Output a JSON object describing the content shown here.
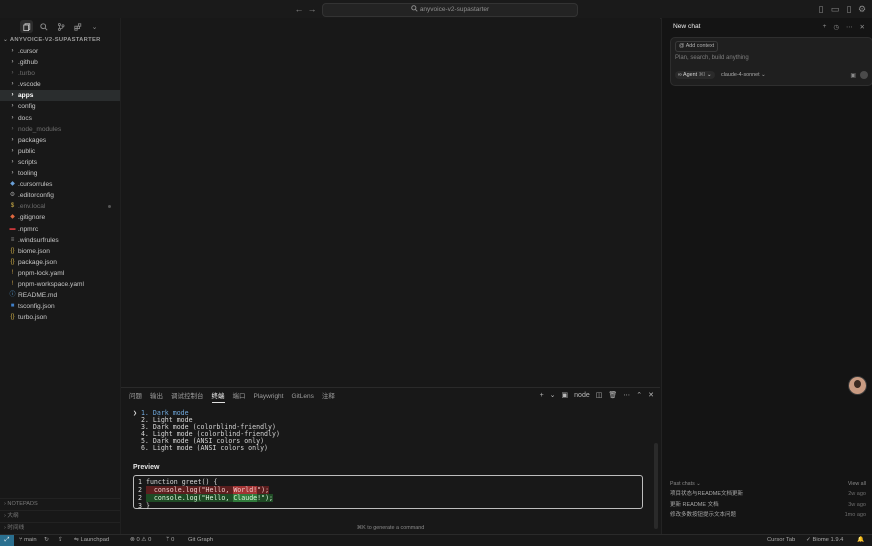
{
  "titlebar": {
    "search_text": "anyvoice-v2-supastarter"
  },
  "explorer": {
    "root": "ANYVOICE-V2-SUPASTARTER",
    "items": [
      {
        "label": ".cursor",
        "icon": "chevron-right-icon",
        "glyph": "›",
        "dim": false,
        "selected": false
      },
      {
        "label": ".github",
        "icon": "chevron-right-icon",
        "glyph": "›",
        "dim": false,
        "selected": false
      },
      {
        "label": ".turbo",
        "icon": "chevron-right-icon",
        "glyph": "›",
        "dim": true,
        "selected": false
      },
      {
        "label": ".vscode",
        "icon": "chevron-right-icon",
        "glyph": "›",
        "dim": false,
        "selected": false
      },
      {
        "label": "apps",
        "icon": "chevron-right-icon",
        "glyph": "›",
        "dim": false,
        "selected": true
      },
      {
        "label": "config",
        "icon": "chevron-right-icon",
        "glyph": "›",
        "dim": false,
        "selected": false
      },
      {
        "label": "docs",
        "icon": "chevron-right-icon",
        "glyph": "›",
        "dim": false,
        "selected": false
      },
      {
        "label": "node_modules",
        "icon": "chevron-right-icon",
        "glyph": "›",
        "dim": true,
        "selected": false
      },
      {
        "label": "packages",
        "icon": "chevron-right-icon",
        "glyph": "›",
        "dim": false,
        "selected": false
      },
      {
        "label": "public",
        "icon": "chevron-right-icon",
        "glyph": "›",
        "dim": false,
        "selected": false
      },
      {
        "label": "scripts",
        "icon": "chevron-right-icon",
        "glyph": "›",
        "dim": false,
        "selected": false
      },
      {
        "label": "tooling",
        "icon": "chevron-right-icon",
        "glyph": "›",
        "dim": false,
        "selected": false
      },
      {
        "label": ".cursorrules",
        "icon": "cursor-file-icon",
        "glyph": "◆",
        "color": "#6aa0d8",
        "dim": false,
        "selected": false
      },
      {
        "label": ".editorconfig",
        "icon": "gear-file-icon",
        "glyph": "⚙",
        "color": "#9a9a9a",
        "dim": false,
        "selected": false
      },
      {
        "label": ".env.local",
        "icon": "dollar-file-icon",
        "glyph": "$",
        "color": "#d6b44a",
        "dim": true,
        "selected": false,
        "dot": true
      },
      {
        "label": ".gitignore",
        "icon": "git-file-icon",
        "glyph": "◆",
        "color": "#e0683f",
        "dim": false,
        "selected": false
      },
      {
        "label": ".npmrc",
        "icon": "npm-file-icon",
        "glyph": "▬",
        "color": "#c9373a",
        "dim": false,
        "selected": false
      },
      {
        "label": ".windsurfrules",
        "icon": "lines-file-icon",
        "glyph": "≡",
        "color": "#9a9a9a",
        "dim": false,
        "selected": false
      },
      {
        "label": "biome.json",
        "icon": "json-file-icon",
        "glyph": "{}",
        "color": "#d6b44a",
        "dim": false,
        "selected": false
      },
      {
        "label": "package.json",
        "icon": "json-file-icon",
        "glyph": "{}",
        "color": "#d6b44a",
        "dim": false,
        "selected": false
      },
      {
        "label": "pnpm-lock.yaml",
        "icon": "yaml-file-icon",
        "glyph": "!",
        "color": "#c9a04a",
        "dim": false,
        "selected": false
      },
      {
        "label": "pnpm-workspace.yaml",
        "icon": "yaml-file-icon",
        "glyph": "!",
        "color": "#c9a04a",
        "dim": false,
        "selected": false
      },
      {
        "label": "README.md",
        "icon": "info-file-icon",
        "glyph": "ⓘ",
        "color": "#5aa0d8",
        "dim": false,
        "selected": false
      },
      {
        "label": "tsconfig.json",
        "icon": "ts-file-icon",
        "glyph": "■",
        "color": "#3f7fc9",
        "dim": false,
        "selected": false
      },
      {
        "label": "turbo.json",
        "icon": "json-file-icon",
        "glyph": "{}",
        "color": "#d6b44a",
        "dim": false,
        "selected": false
      }
    ],
    "outline_label": "NOTEPADS",
    "bottom_items": [
      "大纲",
      "时间线"
    ]
  },
  "panel": {
    "tabs": [
      "问题",
      "输出",
      "调试控制台",
      "终端",
      "端口",
      "Playwright",
      "GitLens",
      "注释"
    ],
    "active_tab": 3,
    "terminal_name": "node",
    "options": [
      {
        "num": "1.",
        "label": "Dark mode",
        "selected": true
      },
      {
        "num": "2.",
        "label": "Light mode",
        "selected": false
      },
      {
        "num": "3.",
        "label": "Dark mode (colorblind-friendly)",
        "selected": false
      },
      {
        "num": "4.",
        "label": "Light mode (colorblind-friendly)",
        "selected": false
      },
      {
        "num": "5.",
        "label": "Dark mode (ANSI colors only)",
        "selected": false
      },
      {
        "num": "6.",
        "label": "Light mode (ANSI colors only)",
        "selected": false
      }
    ],
    "preview_label": "Preview",
    "code": {
      "l1_num": "1",
      "l1": "function greet() {",
      "l2_num": "2",
      "l2_prefix": "  console.log(\"Hello, ",
      "l2_hl": "World!",
      "l2_suffix": "\");",
      "l3_num": "2",
      "l3_prefix": "  console.log(\"Hello, ",
      "l3_hl": "Claude",
      "l3_suffix": "!\");",
      "l4_num": "3",
      "l4": "}"
    },
    "hint": "⌘K to generate a command"
  },
  "chat": {
    "title": "New chat",
    "add_context": "Add context",
    "placeholder": "Plan, search, build anything",
    "agent_label": "Agent",
    "agent_shortcut": "⌘I",
    "model": "claude-4-sonnet",
    "past_header": "Past chats",
    "view_all": "View all",
    "past_chats": [
      {
        "title": "项目状态与README文档更新",
        "age": "2w ago"
      },
      {
        "title": "更新 README 文档",
        "age": "3w ago"
      },
      {
        "title": "修改多数按钮提示文本问题",
        "age": "1mo ago"
      }
    ]
  },
  "statusbar": {
    "branch": "main",
    "problems": "⊗ 0 ⚠ 0",
    "launchpad": "Launchpad",
    "ports": "0",
    "git_graph": "Git Graph",
    "cursor_tab": "Cursor Tab",
    "biome": "Biome 1.9.4"
  }
}
